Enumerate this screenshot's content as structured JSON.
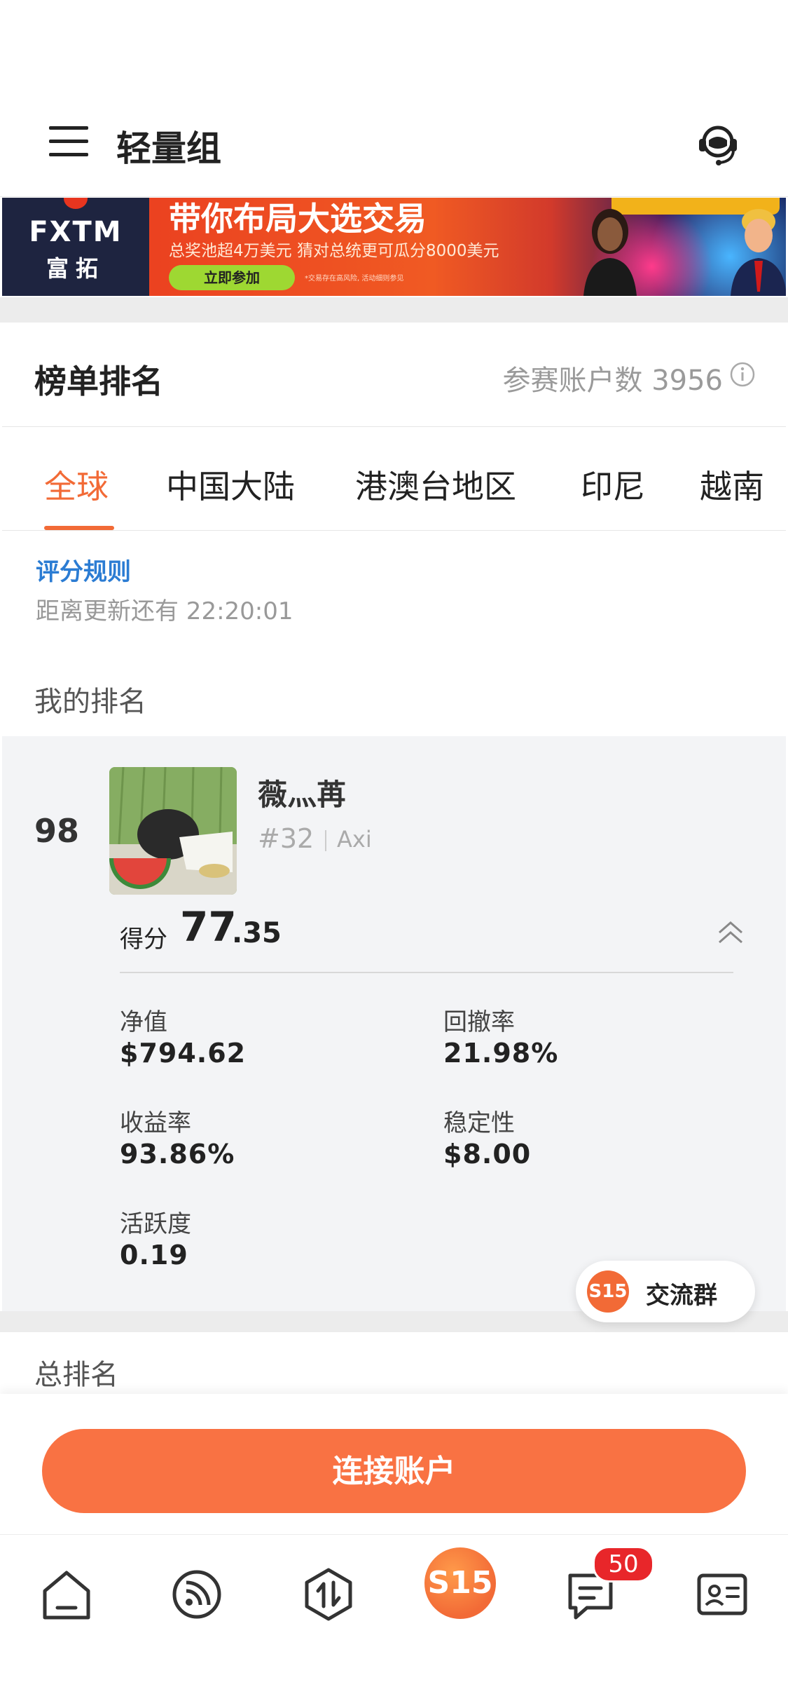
{
  "header": {
    "title": "轻量组"
  },
  "banner": {
    "brand": "FXTM",
    "brand_cn": "富拓",
    "headline": "带你布局大选交易",
    "subline": "总奖池超4万美元 猜对总统更可瓜分8000美元",
    "cta": "立即参加",
    "fine_print": "*交易存在高风险, 活动细则参见"
  },
  "ranking": {
    "title": "榜单排名",
    "participants_label": "参赛账户数 3956"
  },
  "tabs": [
    {
      "label": "全球"
    },
    {
      "label": "中国大陆"
    },
    {
      "label": "港澳台地区"
    },
    {
      "label": "印尼"
    },
    {
      "label": "越南"
    }
  ],
  "rules": {
    "link": "评分规则",
    "countdown": "距离更新还有 22:20:01"
  },
  "my_ranking": {
    "label": "我的排名",
    "rank": "98",
    "username": "薇灬苒",
    "user_rank": "#32",
    "broker": "Axi",
    "score_label": "得分",
    "score_int": "77",
    "score_dec": ".35",
    "metrics": {
      "net_value_label": "净值",
      "net_value": "$794.62",
      "drawdown_label": "回撤率",
      "drawdown": "21.98%",
      "return_label": "收益率",
      "return": "93.86%",
      "stability_label": "稳定性",
      "stability": "$8.00",
      "activity_label": "活跃度",
      "activity": "0.19"
    }
  },
  "chat": {
    "logo": "S15",
    "label": "交流群"
  },
  "overall": {
    "label": "总排名"
  },
  "connect": {
    "label": "连接账户"
  },
  "tabbar": {
    "center_logo": "S15",
    "message_badge": "50",
    "items": [
      "home-icon",
      "feed-icon",
      "trade-icon",
      "s15-icon",
      "message-icon",
      "profile-icon"
    ]
  },
  "colors": {
    "accent": "#f26a36",
    "button": "#f97243",
    "link": "#2b7cd3",
    "badge": "#e8262a"
  }
}
